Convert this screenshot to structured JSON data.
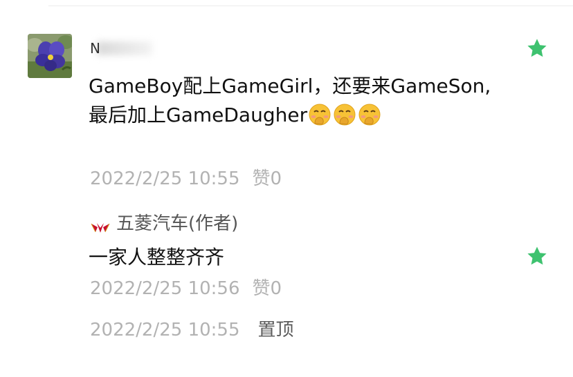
{
  "comment": {
    "username": "N",
    "avatar_icon": "pansy-flower-icon",
    "text": "GameBoy配上GameGirl，还要来GameSon,最后加上GameDaugher",
    "emoji_name": "face-with-hand-over-mouth",
    "emoji_count": 3,
    "timestamp": "2022/2/25 10:55",
    "like_label": "赞0",
    "starred": true
  },
  "reply": {
    "author": "五菱汽车(作者)",
    "author_logo_icon": "wuling-logo-icon",
    "text": "一家人整整齐齐",
    "timestamp": "2022/2/25 10:56",
    "like_label": "赞0",
    "starred": true
  },
  "footer": {
    "timestamp": "2022/2/25 10:55",
    "pin_label": "置顶"
  },
  "colors": {
    "star": "#3ec26f",
    "meta_text": "#b2b2b2",
    "body_text": "#111111"
  }
}
